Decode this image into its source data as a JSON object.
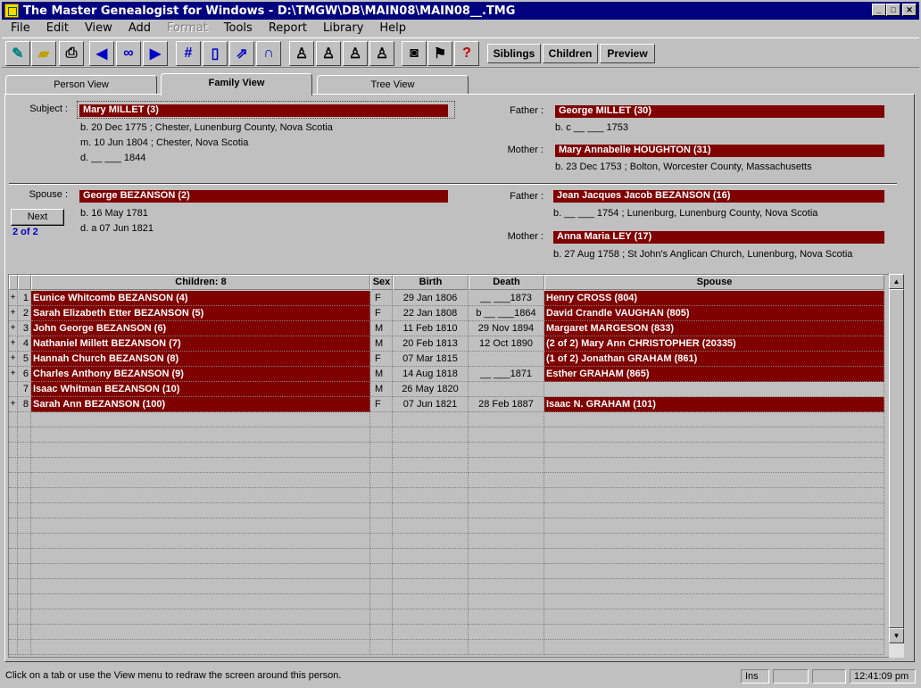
{
  "window": {
    "title": "The Master Genealogist for Windows - D:\\TMGW\\DB\\MAIN08\\MAIN08__.TMG",
    "minimize_label": "_",
    "maximize_label": "□",
    "close_label": "✕"
  },
  "menu": [
    "File",
    "Edit",
    "View",
    "Add",
    "Format",
    "Tools",
    "Report",
    "Library",
    "Help"
  ],
  "toolbar": {
    "siblings_label": "Siblings",
    "children_label": "Children",
    "preview_label": "Preview"
  },
  "tabs": [
    "Person View",
    "Family View",
    "Tree View"
  ],
  "subject": {
    "label": "Subject :",
    "name": "Mary MILLET (3)",
    "birth": "b. 20 Dec 1775 ; Chester, Lunenburg County, Nova Scotia",
    "marriage": "m. 10 Jun 1804 ; Chester, Nova Scotia",
    "death": "d. __ ___ 1844",
    "father_label": "Father :",
    "father_name": "George MILLET (30)",
    "father_detail": "b. c __ ___ 1753",
    "mother_label": "Mother :",
    "mother_name": "Mary Annabelle HOUGHTON (31)",
    "mother_detail": "b. 23 Dec 1753 ; Bolton, Worcester County, Massachusetts"
  },
  "spouse": {
    "label": "Spouse :",
    "name": "George BEZANSON (2)",
    "birth": "b. 16 May 1781",
    "death": "d. a 07 Jun 1821",
    "next_label": "Next",
    "counter": "2 of 2",
    "father_label": "Father :",
    "father_name": "Jean Jacques Jacob BEZANSON (16)",
    "father_detail": "b. __ ___ 1754 ; Lunenburg, Lunenburg County, Nova Scotia",
    "mother_label": "Mother :",
    "mother_name": "Anna Maria LEY (17)",
    "mother_detail": "b. 27 Aug 1758 ; St John's Anglican Church, Lunenburg, Nova Scotia"
  },
  "grid": {
    "headers": {
      "children": "Children: 8",
      "sex": "Sex",
      "birth": "Birth",
      "death": "Death",
      "spouse": "Spouse"
    },
    "rows": [
      {
        "exp": "+",
        "num": "1",
        "name": "Eunice Whitcomb BEZANSON (4)",
        "sex": "F",
        "birth": "29 Jan 1806",
        "death": "__ ___1873",
        "spouse": "Henry CROSS (804)"
      },
      {
        "exp": "+",
        "num": "2",
        "name": "Sarah Elizabeth Etter BEZANSON (5)",
        "sex": "F",
        "birth": "22 Jan 1808",
        "death": "b __ ___1864",
        "spouse": "David Crandle VAUGHAN (805)"
      },
      {
        "exp": "+",
        "num": "3",
        "name": "John George BEZANSON (6)",
        "sex": "M",
        "birth": "11 Feb 1810",
        "death": "29 Nov 1894",
        "spouse": "Margaret MARGESON (833)"
      },
      {
        "exp": "+",
        "num": "4",
        "name": "Nathaniel Millett BEZANSON (7)",
        "sex": "M",
        "birth": "20 Feb 1813",
        "death": "12 Oct 1890",
        "spouse": "(2 of 2) Mary Ann CHRISTOPHER (20335)"
      },
      {
        "exp": "+",
        "num": "5",
        "name": "Hannah Church BEZANSON (8)",
        "sex": "F",
        "birth": "07 Mar 1815",
        "death": "",
        "spouse": "(1 of 2) Jonathan GRAHAM (861)"
      },
      {
        "exp": "+",
        "num": "6",
        "name": "Charles Anthony BEZANSON (9)",
        "sex": "M",
        "birth": "14 Aug 1818",
        "death": "__ ___1871",
        "spouse": "Esther GRAHAM (865)"
      },
      {
        "exp": "",
        "num": "7",
        "name": "Isaac Whitman BEZANSON (10)",
        "sex": "M",
        "birth": "26 May 1820",
        "death": "",
        "spouse": ""
      },
      {
        "exp": "+",
        "num": "8",
        "name": "Sarah Ann BEZANSON (100)",
        "sex": "F",
        "birth": "07 Jun 1821",
        "death": "28 Feb 1887",
        "spouse": "Isaac N. GRAHAM (101)"
      }
    ]
  },
  "status": {
    "message": "Click on a tab or use the View menu to redraw the screen around this person.",
    "ins": "Ins",
    "time": "12:41:09 pm"
  }
}
